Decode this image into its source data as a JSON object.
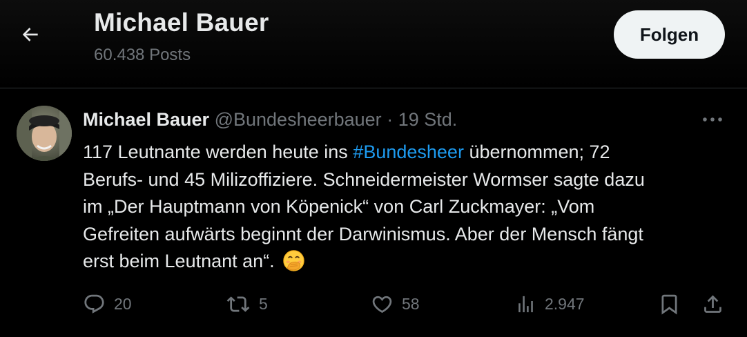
{
  "header": {
    "name": "Michael Bauer",
    "posts": "60.438 Posts",
    "follow_label": "Folgen"
  },
  "tweet": {
    "author_name": "Michael Bauer",
    "handle": "@Bundesheerbauer",
    "separator": "·",
    "time": "19 Std.",
    "text": {
      "line1_pre": "117 Leutnante werden heute ins ",
      "hashtag": "#Bundesheer",
      "line1_post": " übernommen; 72",
      "line2": "Berufs- und 45 Milizoffiziere. Schneidermeister Wormser sagte dazu",
      "line3": "im „Der Hauptmann von Köpenick“ von Carl Zuckmayer: „Vom",
      "line4": "Gefreiten aufwärts beginnt der Darwinismus. Aber der Mensch fängt",
      "line5": "erst beim Leutnant an“."
    },
    "emoji": "face-with-hand-over-mouth-emoji",
    "actions": {
      "replies": "20",
      "reposts": "5",
      "likes": "58",
      "views": "2.947"
    }
  },
  "icons": {
    "back": "arrow-left-icon",
    "more": "more-horizontal-icon",
    "reply": "reply-bubble-icon",
    "repost": "repost-icon",
    "like": "heart-icon",
    "views": "views-bar-icon",
    "bookmark": "bookmark-icon",
    "share": "share-icon"
  },
  "colors": {
    "background": "#000000",
    "text": "#e7e9ea",
    "muted": "#71767b",
    "link": "#1d9bf0",
    "button_bg": "#eff3f4"
  }
}
